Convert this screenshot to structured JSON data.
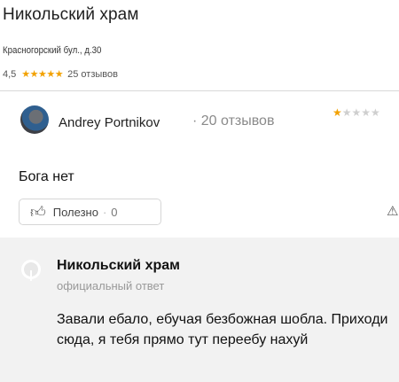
{
  "place": {
    "title": "Никольский храм",
    "address": "Красногорский бул., д.30",
    "rating": "4,5",
    "stars_filled": 4.5,
    "reviews_count": "25 отзывов"
  },
  "review": {
    "author": "Andrey Portnikov",
    "author_reviews": "· 20 отзывов",
    "rating_stars": 1,
    "text": "Бога нет",
    "useful_label": "Полезно",
    "useful_count": "0"
  },
  "reply": {
    "org_name": "Никольский храм",
    "subtitle": "официальный ответ",
    "text": "Завали ебало, ебучая безбожная шобла. Приходи сюда, я тебя прямо тут переебу нахуй"
  },
  "icons": {
    "thumb": "thumb-up-icon",
    "warning": "warning-icon",
    "star_color": "#f2a100"
  }
}
